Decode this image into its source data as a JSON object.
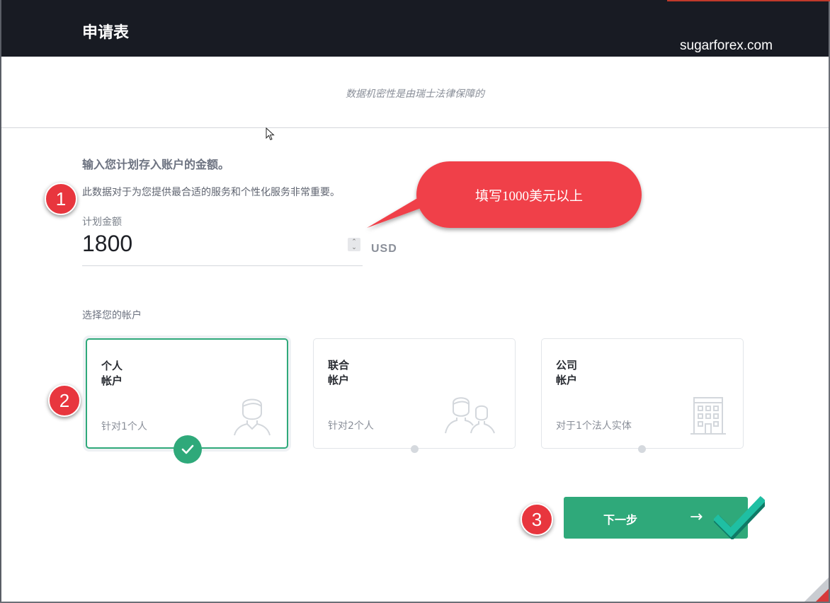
{
  "header": {
    "title": "申请表",
    "watermark": "sugarforex.com"
  },
  "privacy_note": "数据机密性是由瑞士法律保障的",
  "amount_section": {
    "title": "输入您计划存入账户的金额。",
    "description": "此数据对于为您提供最合适的服务和个性化服务非常重要。",
    "field_label": "计划金额",
    "value": "1800",
    "currency": "USD"
  },
  "callout": {
    "text": "填写1000美元以上",
    "color": "#f0414a"
  },
  "badges": [
    "1",
    "2",
    "3"
  ],
  "account_section": {
    "label": "选择您的帐户",
    "options": [
      {
        "title_line1": "个人",
        "title_line2": "帐户",
        "desc": "针对1个人",
        "icon": "person-icon",
        "selected": true
      },
      {
        "title_line1": "联合",
        "title_line2": "帐户",
        "desc": "针对2个人",
        "icon": "two-people-icon",
        "selected": false
      },
      {
        "title_line1": "公司",
        "title_line2": "帐户",
        "desc": "对于1个法人实体",
        "icon": "building-icon",
        "selected": false
      }
    ]
  },
  "next_button": {
    "label": "下一步",
    "arrow": "→"
  },
  "colors": {
    "header_bg": "#181b23",
    "accent_green": "#2fa97a",
    "badge_red": "#e8363e",
    "teal_check": "#1fbfa3"
  }
}
